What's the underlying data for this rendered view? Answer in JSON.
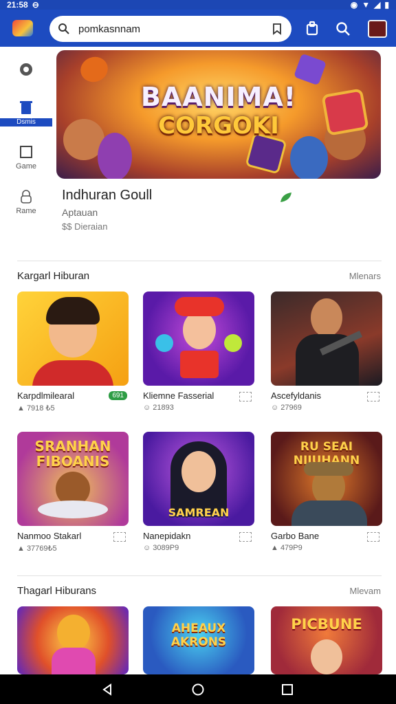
{
  "status_bar": {
    "time": "21:58",
    "indicator": "⊖"
  },
  "search": {
    "query": "pomkasnnam"
  },
  "side_nav": [
    {
      "label": "",
      "icon": "settings-icon"
    },
    {
      "label": "Dsmis",
      "icon": "delete-icon"
    },
    {
      "label": "Game",
      "icon": "game-icon"
    },
    {
      "label": "Rame",
      "icon": "lock-icon"
    }
  ],
  "hero": {
    "line1": "BAANIMA!",
    "line2": "CORGOKI"
  },
  "featured": {
    "title": "Indhuran Goull",
    "subtitle": "Aptauan",
    "meta": "$$ Dieraian"
  },
  "sections": [
    {
      "title": "Kargarl Hiburan",
      "more": "Mlenars",
      "items": [
        {
          "name": "Karpdlmilearal",
          "stat": "▲ 7918 ₺5",
          "badge": "691",
          "thumb_text": ""
        },
        {
          "name": "Kliemne Fasserial",
          "stat": "☺ 21893",
          "badge": "",
          "thumb_text": ""
        },
        {
          "name": "Ascefyldanis",
          "stat": "☺ 27969",
          "badge": "",
          "thumb_text": ""
        },
        {
          "name": "Nanmoo Stakarl",
          "stat": "▲ 37769₺5",
          "badge": "",
          "thumb_text": "SRANHAN FIBOANIS"
        },
        {
          "name": "Nanepidakn",
          "stat": "☺ 3089P9",
          "badge": "",
          "thumb_text": "SAMREAN"
        },
        {
          "name": "Garbo Bane",
          "stat": "▲ 479P9",
          "badge": "",
          "thumb_text": "RU SEAI NIIUHANN"
        }
      ]
    },
    {
      "title": "Thagarl Hiburans",
      "more": "Mlevam",
      "items": [
        {
          "name": "",
          "stat": "",
          "badge": "",
          "thumb_text": ""
        },
        {
          "name": "",
          "stat": "",
          "badge": "",
          "thumb_text": "AHEAUX AKRONS"
        },
        {
          "name": "",
          "stat": "",
          "badge": "",
          "thumb_text": "PICBUNE"
        }
      ]
    }
  ],
  "colors": {
    "primary": "#1d4bc0",
    "badge_green": "#2e9d45"
  }
}
